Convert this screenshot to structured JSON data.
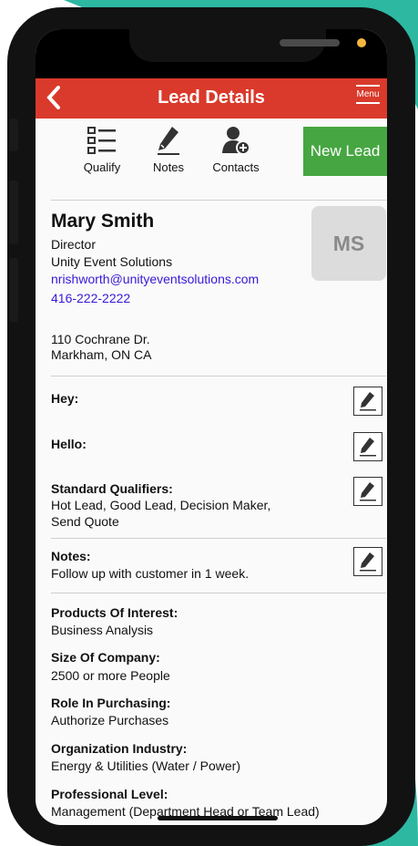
{
  "header": {
    "back_icon": "chevron-left-icon",
    "title": "Lead Details",
    "menu_label": "Menu"
  },
  "toolbar": {
    "qualify": "Qualify",
    "notes": "Notes",
    "contacts": "Contacts",
    "new_lead": "New Lead"
  },
  "contact": {
    "name": "Mary Smith",
    "title": "Director",
    "company": "Unity Event Solutions",
    "email": "nrishworth@unityeventsolutions.com",
    "phone": "416-222-2222",
    "initials": "MS",
    "address_line1": "110 Cochrane Dr.",
    "address_line2": "Markham, ON  CA"
  },
  "fields": {
    "hey_label": "Hey:",
    "hello_label": "Hello:",
    "qualifiers_label": "Standard Qualifiers:",
    "qualifiers_value_1": "Hot Lead, Good Lead, Decision Maker,",
    "qualifiers_value_2": "Send Quote",
    "notes_label": "Notes:",
    "notes_value": "Follow up with customer in 1 week.",
    "products_label": "Products Of Interest:",
    "products_value": "Business Analysis",
    "size_label": "Size Of Company:",
    "size_value": "2500 or more People",
    "role_label": "Role In Purchasing:",
    "role_value": "Authorize Purchases",
    "industry_label": "Organization Industry:",
    "industry_value": "Energy & Utilities (Water / Power)",
    "level_label": "Professional Level:",
    "level_value": "Management (Department Head or Team Lead)"
  },
  "colors": {
    "header_red": "#d93a2b",
    "new_lead_green": "#46a641",
    "link_blue": "#3a18d8",
    "teal_bg": "#2db8a2"
  }
}
